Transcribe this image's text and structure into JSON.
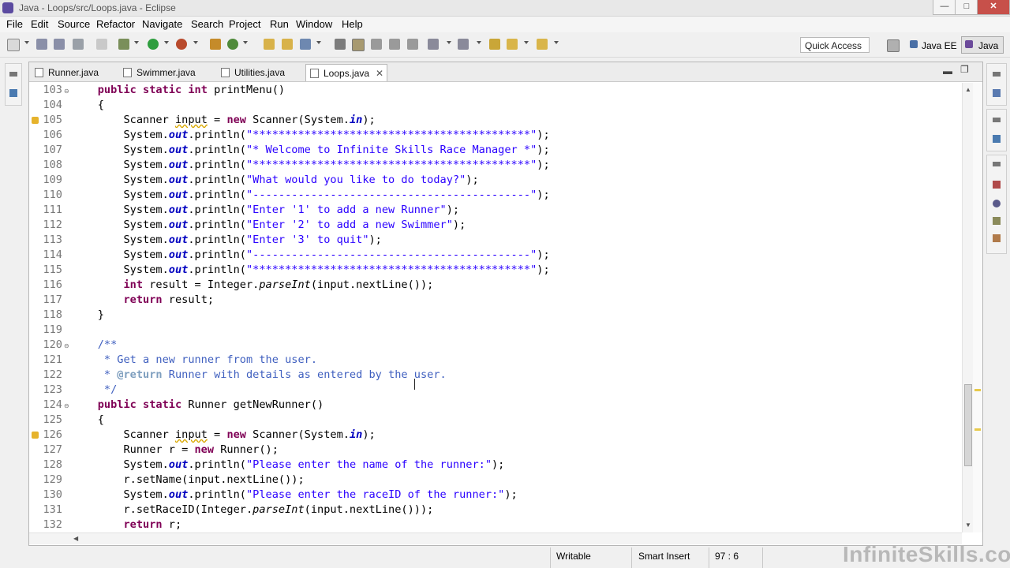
{
  "window": {
    "title": "Java - Loops/src/Loops.java - Eclipse",
    "minimize": "—",
    "maximize": "□",
    "close": "✕"
  },
  "menu": [
    "File",
    "Edit",
    "Source",
    "Refactor",
    "Navigate",
    "Search",
    "Project",
    "Run",
    "Window",
    "Help"
  ],
  "toolbar": {
    "quick_access": "Quick Access",
    "perspectives": [
      "Java EE",
      "Java"
    ]
  },
  "tabs": [
    {
      "label": "Runner.java",
      "active": false
    },
    {
      "label": "Swimmer.java",
      "active": false
    },
    {
      "label": "Utilities.java",
      "active": false
    },
    {
      "label": "Loops.java",
      "active": true
    }
  ],
  "code_lines": [
    {
      "n": "103",
      "fold": true,
      "warn": false,
      "html": "    <span class=\"kw\">public static int</span> printMenu()"
    },
    {
      "n": "104",
      "fold": false,
      "warn": false,
      "html": "    {"
    },
    {
      "n": "105",
      "fold": false,
      "warn": true,
      "html": "        Scanner <span class=\"squig\">input</span> = <span class=\"kw\">new</span> Scanner(System.<span class=\"fld\">in</span>);"
    },
    {
      "n": "106",
      "fold": false,
      "warn": false,
      "html": "        System.<span class=\"fld\">out</span>.println(<span class=\"str\">\"*******************************************\"</span>);"
    },
    {
      "n": "107",
      "fold": false,
      "warn": false,
      "html": "        System.<span class=\"fld\">out</span>.println(<span class=\"str\">\"* Welcome to Infinite Skills Race Manager *\"</span>);"
    },
    {
      "n": "108",
      "fold": false,
      "warn": false,
      "html": "        System.<span class=\"fld\">out</span>.println(<span class=\"str\">\"*******************************************\"</span>);"
    },
    {
      "n": "109",
      "fold": false,
      "warn": false,
      "html": "        System.<span class=\"fld\">out</span>.println(<span class=\"str\">\"What would you like to do today?\"</span>);"
    },
    {
      "n": "110",
      "fold": false,
      "warn": false,
      "html": "        System.<span class=\"fld\">out</span>.println(<span class=\"str\">\"-------------------------------------------\"</span>);"
    },
    {
      "n": "111",
      "fold": false,
      "warn": false,
      "html": "        System.<span class=\"fld\">out</span>.println(<span class=\"str\">\"Enter '1' to add a new Runner\"</span>);"
    },
    {
      "n": "112",
      "fold": false,
      "warn": false,
      "html": "        System.<span class=\"fld\">out</span>.println(<span class=\"str\">\"Enter '2' to add a new Swimmer\"</span>);"
    },
    {
      "n": "113",
      "fold": false,
      "warn": false,
      "html": "        System.<span class=\"fld\">out</span>.println(<span class=\"str\">\"Enter '3' to quit\"</span>);"
    },
    {
      "n": "114",
      "fold": false,
      "warn": false,
      "html": "        System.<span class=\"fld\">out</span>.println(<span class=\"str\">\"-------------------------------------------\"</span>);"
    },
    {
      "n": "115",
      "fold": false,
      "warn": false,
      "html": "        System.<span class=\"fld\">out</span>.println(<span class=\"str\">\"*******************************************\"</span>);"
    },
    {
      "n": "116",
      "fold": false,
      "warn": false,
      "html": "        <span class=\"kw\">int</span> result = Integer.<span class=\"it\">parseInt</span>(input.nextLine());"
    },
    {
      "n": "117",
      "fold": false,
      "warn": false,
      "html": "        <span class=\"kw\">return</span> result;"
    },
    {
      "n": "118",
      "fold": false,
      "warn": false,
      "html": "    }"
    },
    {
      "n": "119",
      "fold": false,
      "warn": false,
      "html": ""
    },
    {
      "n": "120",
      "fold": true,
      "warn": false,
      "html": "    <span class=\"cmt\">/**</span>"
    },
    {
      "n": "121",
      "fold": false,
      "warn": false,
      "html": "<span class=\"cmt\">     * Get a new runner from the user.</span>"
    },
    {
      "n": "122",
      "fold": false,
      "warn": false,
      "html": "<span class=\"cmt\">     * </span><span class=\"tag\">@return</span><span class=\"cmt\"> Runner with details as entered by the user.</span>"
    },
    {
      "n": "123",
      "fold": false,
      "warn": false,
      "html": "<span class=\"cmt\">     */</span>"
    },
    {
      "n": "124",
      "fold": true,
      "warn": false,
      "html": "    <span class=\"kw\">public static</span> Runner getNewRunner()"
    },
    {
      "n": "125",
      "fold": false,
      "warn": false,
      "html": "    {"
    },
    {
      "n": "126",
      "fold": false,
      "warn": true,
      "html": "        Scanner <span class=\"squig\">input</span> = <span class=\"kw\">new</span> Scanner(System.<span class=\"fld\">in</span>);"
    },
    {
      "n": "127",
      "fold": false,
      "warn": false,
      "html": "        Runner r = <span class=\"kw\">new</span> Runner();"
    },
    {
      "n": "128",
      "fold": false,
      "warn": false,
      "html": "        System.<span class=\"fld\">out</span>.println(<span class=\"str\">\"Please enter the name of the runner:\"</span>);"
    },
    {
      "n": "129",
      "fold": false,
      "warn": false,
      "html": "        r.setName(input.nextLine());"
    },
    {
      "n": "130",
      "fold": false,
      "warn": false,
      "html": "        System.<span class=\"fld\">out</span>.println(<span class=\"str\">\"Please enter the raceID of the runner:\"</span>);"
    },
    {
      "n": "131",
      "fold": false,
      "warn": false,
      "html": "        r.setRaceID(Integer.<span class=\"it\">parseInt</span>(input.nextLine()));"
    },
    {
      "n": "132",
      "fold": false,
      "warn": false,
      "html": "        <span class=\"kw\">return</span> r;"
    }
  ],
  "status": {
    "writable": "Writable",
    "insert_mode": "Smart Insert",
    "position": "97 : 6"
  },
  "watermark": "InfiniteSkills.com"
}
